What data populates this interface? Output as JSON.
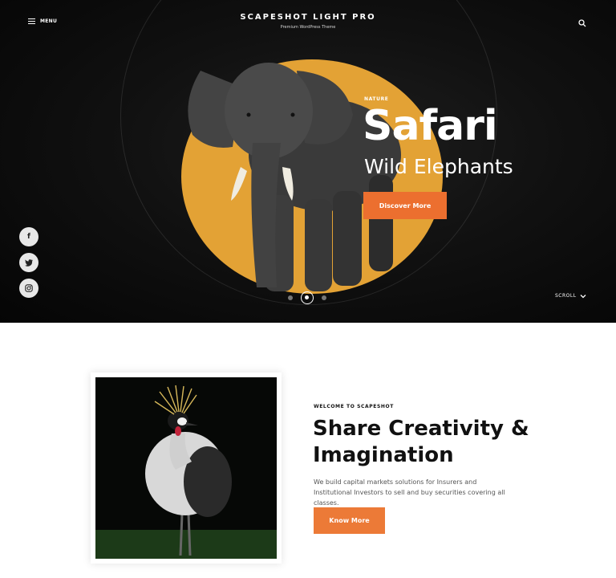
{
  "header": {
    "menu_label": "MENU",
    "site_title": "SCAPESHOT LIGHT PRO",
    "tagline": "Premium WordPress Theme",
    "search_icon": "search-icon",
    "menu_icon": "hamburger-icon"
  },
  "hero": {
    "kicker": "NATURE",
    "title": "Safari",
    "subtitle": "Wild Elephants",
    "button_label": "Discover More",
    "scroll_label": "SCROLL",
    "scroll_icon": "chevron-down-icon",
    "active_slide": 2,
    "slide_count": 3,
    "social": [
      {
        "icon": "facebook-icon",
        "glyph": "f"
      },
      {
        "icon": "twitter-icon",
        "glyph": "t"
      },
      {
        "icon": "instagram-icon",
        "glyph": "◎"
      }
    ]
  },
  "about": {
    "kicker": "WELCOME TO SCAPESHOT",
    "headline": "Share Creativity & Imagination",
    "description": "We build capital markets solutions for Insurers and Institutional Investors to sell and buy securities covering all classes.",
    "button_label": "Know More"
  },
  "colors": {
    "accent": "#ec6f2f",
    "hero_disc": "#e3a235",
    "hero_bg": "#111111"
  }
}
